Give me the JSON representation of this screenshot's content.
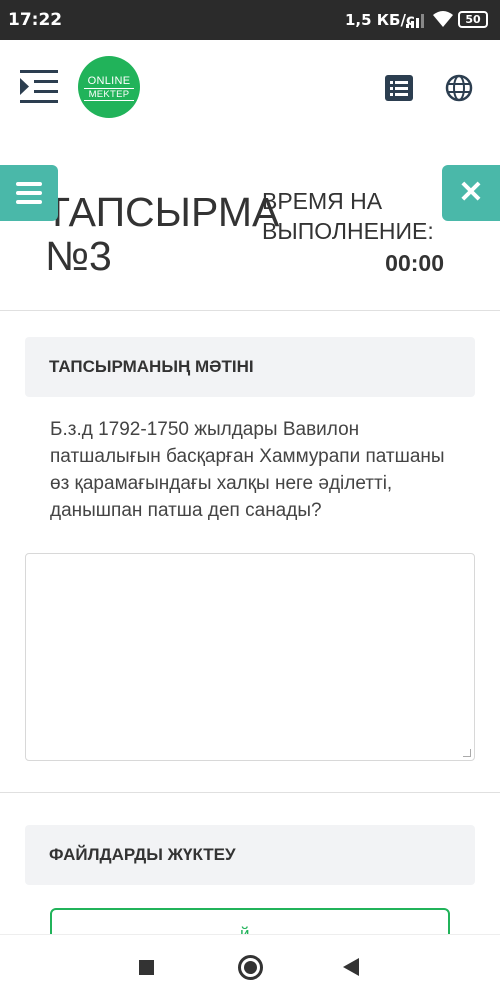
{
  "status_bar": {
    "time": "17:22",
    "speed": "1,5 КБ/с",
    "battery": "50"
  },
  "header": {
    "logo_line1": "ONLINE",
    "logo_line2": "MEKTEP",
    "brand_color": "#21b35a",
    "icons": [
      "menu-indent-icon",
      "list-icon",
      "globe-icon"
    ]
  },
  "task": {
    "title": "ТАПСЫРМА №3",
    "time_label": "ВРЕМЯ НА ВЫПОЛНЕНИЕ:",
    "time_value": "00:00",
    "accent_color": "#4ab8a9"
  },
  "task_text": {
    "heading": "ТАПСЫРМАНЫҢ МӘТІНІ",
    "body": "Б.з.д 1792-1750 жылдары Вавилон патшалығын басқарған Хаммурапи патшаны өз қарамағындағы халқы неге әділетті, данышпан патша деп санады?"
  },
  "answer": {
    "value": ""
  },
  "upload": {
    "heading": "ФАЙЛДАРДЫ ЖҮКТЕУ",
    "button_partial": "й"
  }
}
